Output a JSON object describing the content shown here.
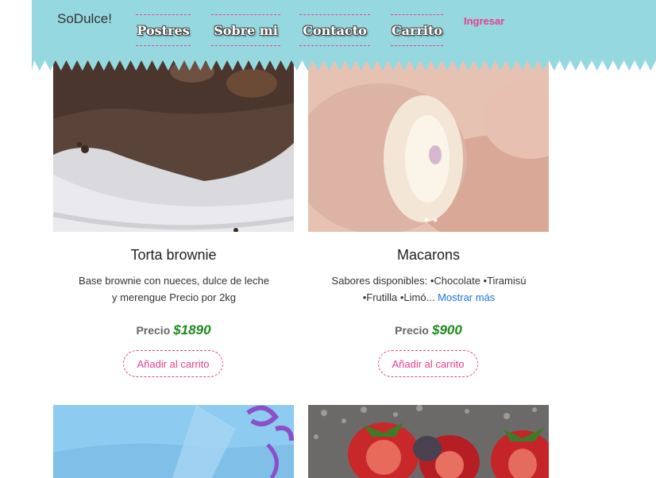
{
  "brand": "SoDulce!",
  "nav": [
    {
      "label": "Postres"
    },
    {
      "label": "Sobre mi"
    },
    {
      "label": "Contacto"
    },
    {
      "label": "Carrito"
    }
  ],
  "login_label": "Ingresar",
  "colors": {
    "header_bg": "#95d8e0",
    "accent_pink": "#e83e8c",
    "price_green": "#1e8a1e",
    "link_blue": "#1a73e8"
  },
  "products": [
    {
      "title": "Torta brownie",
      "description": "Base brownie con nueces, dulce de leche y merengue Precio por 2kg",
      "price_label": "Precio",
      "price": "$1890",
      "button_label": "Añadir al carrito",
      "image_icon": "brownie-photo"
    },
    {
      "title": "Macarons",
      "description": "Sabores disponibles: •Chocolate •Tiramisú •Frutilla •Limó...",
      "more_label": "Mostrar más",
      "price_label": "Precio",
      "price": "$900",
      "button_label": "Añadir al carrito",
      "image_icon": "macarons-photo"
    }
  ],
  "more_products": [
    {
      "image_icon": "ribbon-cake-photo"
    },
    {
      "image_icon": "strawberries-photo"
    }
  ]
}
